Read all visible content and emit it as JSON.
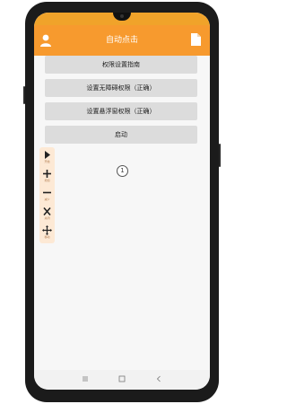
{
  "app": {
    "title": "自动点击"
  },
  "header": {
    "left_icon": "user-icon",
    "right_icon": "file-icon"
  },
  "buttons": [
    {
      "label": "权限设置指南"
    },
    {
      "label": "设置无障碍权限（正确）"
    },
    {
      "label": "设置悬浮窗权限（正确）"
    },
    {
      "label": "启动"
    }
  ],
  "float_panel": {
    "items": [
      {
        "icon": "play-icon",
        "label": "开始"
      },
      {
        "icon": "plus-icon",
        "label": "增加"
      },
      {
        "icon": "minus-icon",
        "label": "减少"
      },
      {
        "icon": "close-icon",
        "label": "关闭"
      },
      {
        "icon": "move-icon",
        "label": "移动"
      }
    ]
  },
  "marker": {
    "text": "1"
  },
  "nav": {
    "items": [
      "menu-icon",
      "home-icon",
      "back-icon"
    ]
  },
  "colors": {
    "accent": "#f79a2e",
    "status_bar": "#f0a32a",
    "button_bg": "#dcdcdc",
    "panel_bg": "#fde9d5"
  }
}
